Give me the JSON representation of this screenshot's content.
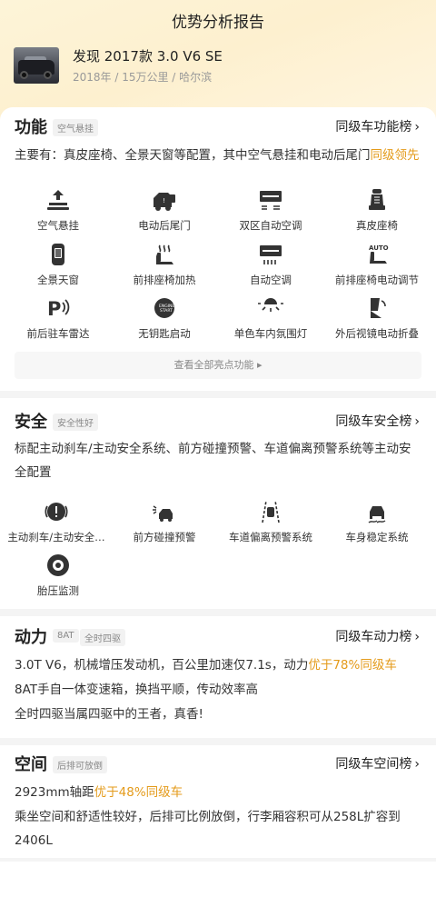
{
  "header": {
    "title": "优势分析报告"
  },
  "car": {
    "name": "发现 2017款 3.0 V6 SE",
    "meta": "2018年 / 15万公里 / 哈尔滨"
  },
  "function": {
    "title": "功能",
    "tag": "空气悬挂",
    "rank": "同级车功能榜",
    "desc_prefix": "主要有：真皮座椅、全景天窗等配置，其中空气悬挂和电动后尾门",
    "desc_highlight": "同级领先",
    "features": [
      {
        "label": "空气悬挂",
        "icon": "air-suspension-icon"
      },
      {
        "label": "电动后尾门",
        "icon": "power-tailgate-icon"
      },
      {
        "label": "双区自动空调",
        "icon": "dual-zone-ac-icon"
      },
      {
        "label": "真皮座椅",
        "icon": "leather-seat-icon"
      },
      {
        "label": "全景天窗",
        "icon": "panoramic-sunroof-icon"
      },
      {
        "label": "前排座椅加热",
        "icon": "seat-heating-icon"
      },
      {
        "label": "自动空调",
        "icon": "auto-ac-icon"
      },
      {
        "label": "前排座椅电动调节",
        "icon": "power-seat-icon"
      },
      {
        "label": "前后驻车雷达",
        "icon": "parking-radar-icon"
      },
      {
        "label": "无钥匙启动",
        "icon": "keyless-start-icon"
      },
      {
        "label": "单色车内氛围灯",
        "icon": "ambient-light-icon"
      },
      {
        "label": "外后视镜电动折叠",
        "icon": "mirror-fold-icon"
      }
    ],
    "view_all": "查看全部亮点功能"
  },
  "safety": {
    "title": "安全",
    "tag": "安全性好",
    "rank": "同级车安全榜",
    "desc": "标配主动刹车/主动安全系统、前方碰撞预警、车道偏离预警系统等主动安全配置",
    "features": [
      {
        "label": "主动刹车/主动安全…",
        "icon": "active-brake-icon"
      },
      {
        "label": "前方碰撞预警",
        "icon": "collision-warning-icon"
      },
      {
        "label": "车道偏离预警系统",
        "icon": "lane-departure-icon"
      },
      {
        "label": "车身稳定系统",
        "icon": "stability-control-icon"
      },
      {
        "label": "胎压监测",
        "icon": "tire-pressure-icon"
      }
    ]
  },
  "power": {
    "title": "动力",
    "tags": [
      "8AT",
      "全时四驱"
    ],
    "rank": "同级车动力榜",
    "line1_prefix": "3.0T V6，机械增压发动机，百公里加速仅7.1s，动力",
    "line1_highlight": "优于78%同级车",
    "line2": "8AT手自一体变速箱，换挡平顺，传动效率高",
    "line3": "全时四驱当属四驱中的王者，真香!"
  },
  "space": {
    "title": "空间",
    "tag": "后排可放倒",
    "rank": "同级车空间榜",
    "line1_prefix": "2923mm轴距",
    "line1_highlight": "优于48%同级车",
    "line2": "乘坐空间和舒适性较好，后排可比例放倒，行李厢容积可从258L扩容到2406L"
  },
  "colors": {
    "highlight": "#e49b1b",
    "icon": "#333333",
    "hero_bg": "#fdf4d8"
  }
}
